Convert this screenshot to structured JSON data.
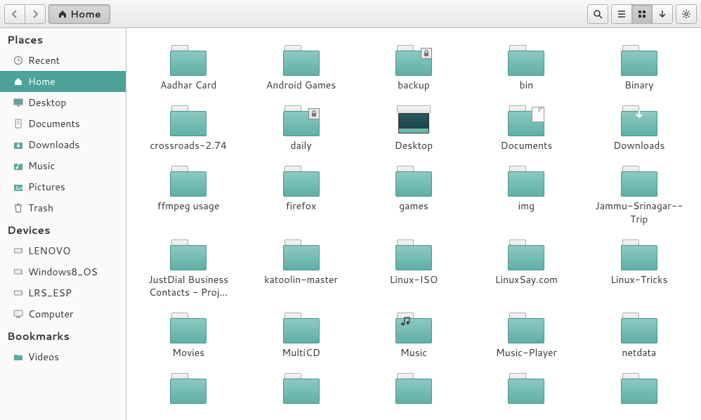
{
  "toolbar": {
    "path_label": "Home"
  },
  "sidebar": {
    "sections": [
      {
        "header": "Places",
        "items": [
          {
            "label": "Recent",
            "icon": "recent",
            "selected": false
          },
          {
            "label": "Home",
            "icon": "home",
            "selected": true
          },
          {
            "label": "Desktop",
            "icon": "desktop",
            "selected": false
          },
          {
            "label": "Documents",
            "icon": "docs",
            "selected": false
          },
          {
            "label": "Downloads",
            "icon": "downloads",
            "selected": false
          },
          {
            "label": "Music",
            "icon": "music",
            "selected": false
          },
          {
            "label": "Pictures",
            "icon": "pictures",
            "selected": false
          },
          {
            "label": "Trash",
            "icon": "trash",
            "selected": false
          }
        ]
      },
      {
        "header": "Devices",
        "items": [
          {
            "label": "LENOVO",
            "icon": "drive",
            "selected": false
          },
          {
            "label": "Windows8_OS",
            "icon": "drive",
            "selected": false
          },
          {
            "label": "LRS_ESP",
            "icon": "drive",
            "selected": false
          },
          {
            "label": "Computer",
            "icon": "computer",
            "selected": false
          }
        ]
      },
      {
        "header": "Bookmarks",
        "items": [
          {
            "label": "Videos",
            "icon": "folder",
            "selected": false
          }
        ]
      }
    ]
  },
  "files": [
    {
      "label": "Aadhar Card",
      "type": "folder"
    },
    {
      "label": "Android Games",
      "type": "folder"
    },
    {
      "label": "backup",
      "type": "folder",
      "badge": "lock"
    },
    {
      "label": "bin",
      "type": "folder"
    },
    {
      "label": "Binary",
      "type": "folder"
    },
    {
      "label": "crossroads-2.74",
      "type": "folder"
    },
    {
      "label": "daily",
      "type": "folder",
      "badge": "lock"
    },
    {
      "label": "Desktop",
      "type": "desktop"
    },
    {
      "label": "Documents",
      "type": "folder",
      "badge": "doc"
    },
    {
      "label": "Downloads",
      "type": "folder",
      "badge": "dl"
    },
    {
      "label": "ffmpeg usage",
      "type": "folder"
    },
    {
      "label": "firefox",
      "type": "folder"
    },
    {
      "label": "games",
      "type": "folder"
    },
    {
      "label": "img",
      "type": "folder"
    },
    {
      "label": "Jammu-Srinagar--Trip",
      "type": "folder"
    },
    {
      "label": "JustDial Business Contacts - Proj...",
      "type": "folder"
    },
    {
      "label": "katoolin-master",
      "type": "folder"
    },
    {
      "label": "Linux-ISO",
      "type": "folder"
    },
    {
      "label": "LinuxSay.com",
      "type": "folder"
    },
    {
      "label": "Linux-Tricks",
      "type": "folder"
    },
    {
      "label": "Movies",
      "type": "folder"
    },
    {
      "label": "MultiCD",
      "type": "folder"
    },
    {
      "label": "Music",
      "type": "folder",
      "badge": "music"
    },
    {
      "label": "Music-Player",
      "type": "folder"
    },
    {
      "label": "netdata",
      "type": "folder"
    }
  ],
  "partial_next_row_count": 5
}
